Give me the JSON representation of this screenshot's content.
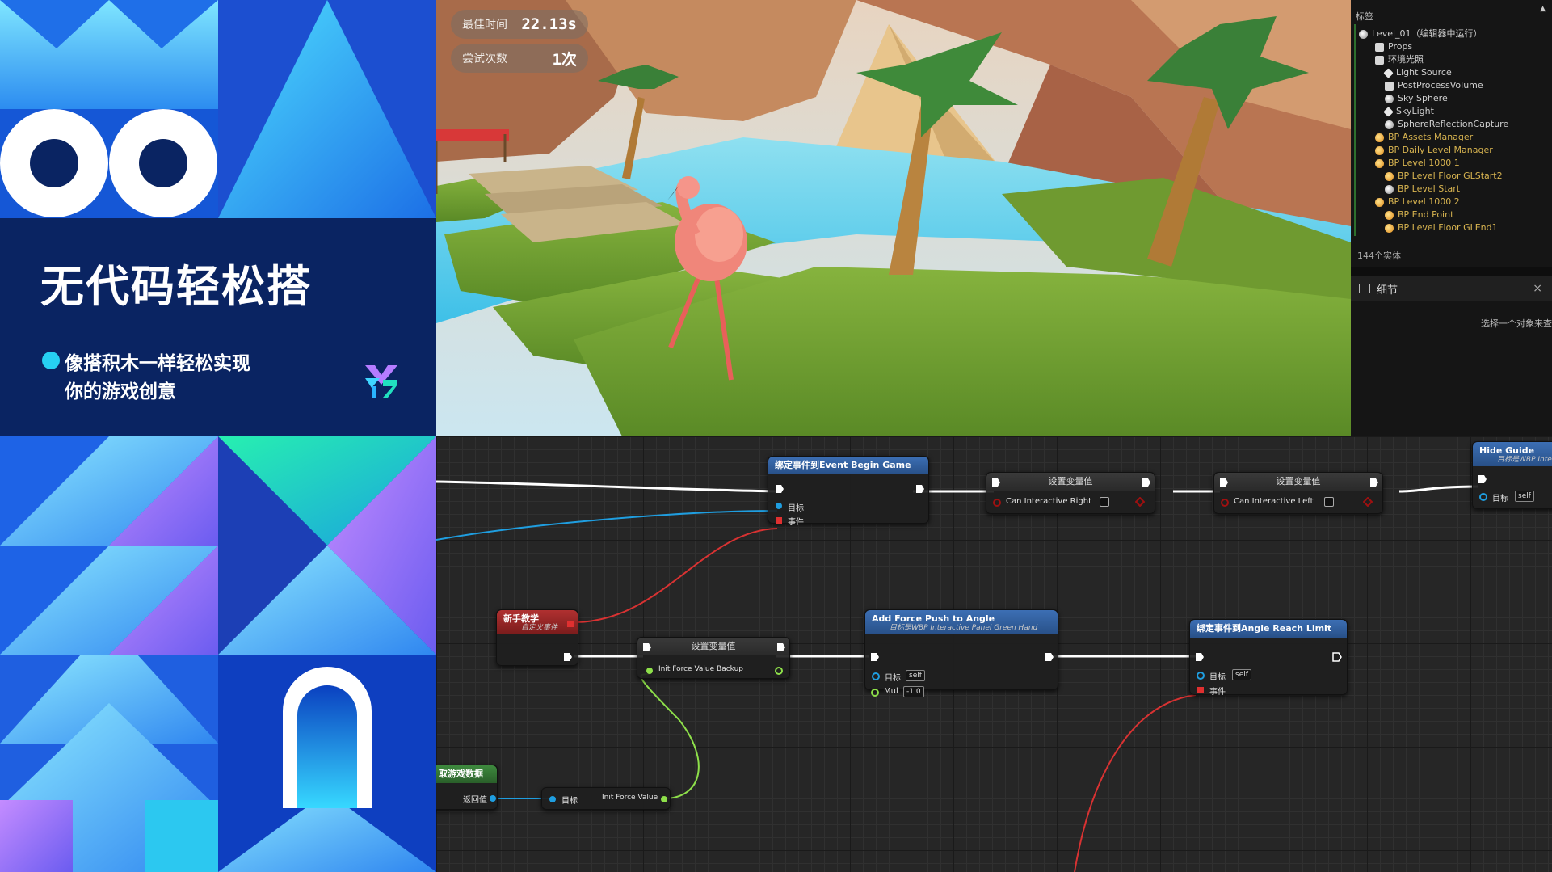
{
  "promo": {
    "title": "无代码轻松搭",
    "subtitle_line1": "像搭积木一样轻松实现",
    "subtitle_line2": "你的游戏创意"
  },
  "hud": {
    "best_time_label": "最佳时间",
    "best_time_value": "22.13s",
    "attempts_label": "尝试次数",
    "attempts_value": "1次"
  },
  "outliner": {
    "header": "标签",
    "items": [
      {
        "label": "Level_01（编辑器中运行）",
        "icon": "level-icon",
        "depth": 0
      },
      {
        "label": "Props",
        "icon": "folder-icon",
        "depth": 1
      },
      {
        "label": "环境光照",
        "icon": "folder-icon",
        "depth": 1
      },
      {
        "label": "Light Source",
        "icon": "light-icon",
        "depth": 2
      },
      {
        "label": "PostProcessVolume",
        "icon": "volume-icon",
        "depth": 2
      },
      {
        "label": "Sky Sphere",
        "icon": "actor-icon",
        "depth": 2
      },
      {
        "label": "SkyLight",
        "icon": "skylight-icon",
        "depth": 2
      },
      {
        "label": "SphereReflectionCapture",
        "icon": "capture-icon",
        "depth": 2
      },
      {
        "label": "BP Assets Manager",
        "icon": "blueprint-icon",
        "depth": 1
      },
      {
        "label": "BP Daily Level Manager",
        "icon": "blueprint-icon",
        "depth": 1
      },
      {
        "label": "BP Level 1000 1",
        "icon": "blueprint-icon",
        "depth": 1
      },
      {
        "label": "BP Level Floor GLStart2",
        "icon": "blueprint-icon",
        "depth": 2
      },
      {
        "label": "BP Level Start",
        "icon": "actor-icon",
        "depth": 2
      },
      {
        "label": "BP Level 1000 2",
        "icon": "blueprint-icon",
        "depth": 1
      },
      {
        "label": "BP End Point",
        "icon": "blueprint-icon",
        "depth": 2
      },
      {
        "label": "BP Level Floor GLEnd1",
        "icon": "blueprint-icon",
        "depth": 2
      }
    ],
    "count": "144个实体",
    "details_tab": "细节",
    "details_close": "×",
    "details_hint": "选择一个对象来查"
  },
  "graph": {
    "bind_event_begin": {
      "title": "绑定事件到Event Begin Game",
      "pin_target": "目标",
      "pin_event": "事件"
    },
    "set_var_right": {
      "title": "设置变量值",
      "pin": "Can Interactive Right"
    },
    "set_var_left": {
      "title": "设置变量值",
      "pin": "Can Interactive Left"
    },
    "hide_guide": {
      "title": "Hide Guide",
      "subtitle": "目标是WBP Inter",
      "pin_target": "目标",
      "self": "self"
    },
    "custom_event": {
      "title": "新手教学",
      "subtitle": "自定义事件"
    },
    "set_var_backup": {
      "title": "设置变量值",
      "pin": "Init Force Value Backup"
    },
    "add_force": {
      "title": "Add Force Push to Angle",
      "subtitle": "目标是WBP Interactive Panel Green Hand",
      "pin_target": "目标",
      "self": "self",
      "pin_mul": "Mul",
      "mul_value": "-1.0"
    },
    "bind_angle": {
      "title": "绑定事件到Angle Reach Limit",
      "pin_target": "目标",
      "self": "self",
      "pin_event": "事件"
    },
    "get_game_data": {
      "title": "取游戏数据",
      "pin_return": "返回值"
    },
    "getter": {
      "pin_target": "目标",
      "pin_value": "Init Force Value"
    }
  },
  "colors": {
    "exec": "#ffffff",
    "object_pin": "#1f9ee0",
    "delegate_pin": "#e03030",
    "bool_pin": "#a01010",
    "float_pin": "#8ee04a"
  }
}
